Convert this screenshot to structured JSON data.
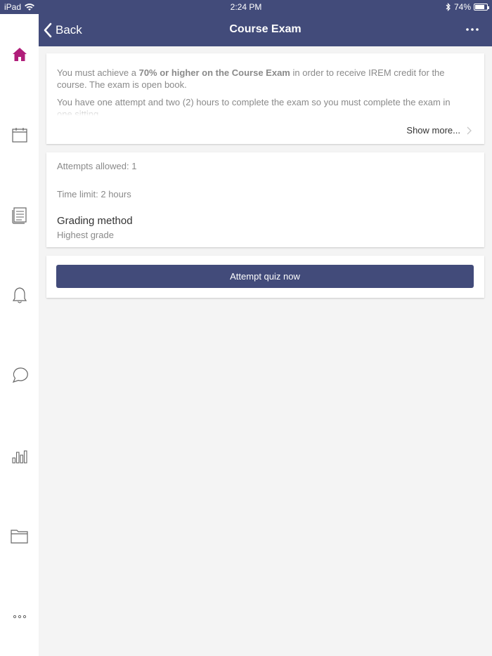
{
  "status_bar": {
    "device": "iPad",
    "time": "2:24 PM",
    "battery": "74%",
    "battery_level": 0.74,
    "wifi_icon": "wifi-icon",
    "bluetooth_icon": "bluetooth-icon"
  },
  "navbar": {
    "back_label": "Back",
    "title": "Course Exam",
    "more_icon": "ellipsis-icon"
  },
  "sidebar": {
    "items": [
      {
        "icon": "home-icon",
        "active": true
      },
      {
        "icon": "calendar-icon",
        "active": false
      },
      {
        "icon": "document-icon",
        "active": false
      },
      {
        "icon": "bell-icon",
        "active": false
      },
      {
        "icon": "chat-icon",
        "active": false
      },
      {
        "icon": "bar-chart-icon",
        "active": false
      },
      {
        "icon": "folder-icon",
        "active": false
      },
      {
        "icon": "more-icon",
        "active": false
      }
    ],
    "active_color": "#b01e7a",
    "inactive_color": "#666666"
  },
  "intro": {
    "p1_before": "You must achieve a ",
    "p1_bold": "70% or higher on the Course Exam",
    "p1_after": " in order to receive IREM credit for the course. The exam is open book.",
    "p2": "You have one attempt and two (2) hours to complete the exam so you must complete the exam in one sitting.",
    "show_more": "Show more..."
  },
  "details": {
    "attempts": "Attempts allowed: 1",
    "time_limit": "Time limit: 2 hours",
    "grading_title": "Grading method",
    "grading_value": "Highest grade"
  },
  "action": {
    "attempt_label": "Attempt quiz now"
  },
  "colors": {
    "brand": "#424b7a",
    "background": "#f4f4f4"
  }
}
